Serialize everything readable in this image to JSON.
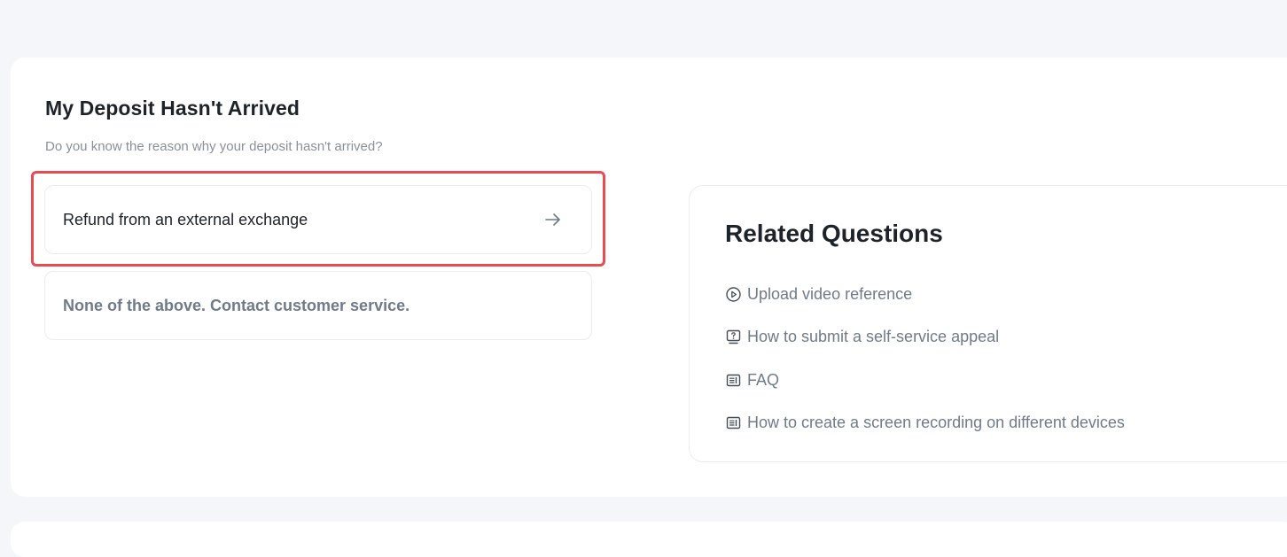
{
  "deposit": {
    "title": "My Deposit Hasn't Arrived",
    "subtitle": "Do you know the reason why your deposit hasn't arrived?",
    "options": [
      {
        "label": "Refund from an external exchange",
        "icon": "arrow-right-icon",
        "highlighted": true
      },
      {
        "label": "None of the above. Contact customer service."
      }
    ]
  },
  "related": {
    "title": "Related Questions",
    "items": [
      {
        "label": "Upload video reference",
        "icon": "play-circle-icon"
      },
      {
        "label": "How to submit a self-service appeal",
        "icon": "question-box-icon"
      },
      {
        "label": "FAQ",
        "icon": "document-icon"
      },
      {
        "label": "How to create a screen recording on different devices",
        "icon": "document-icon"
      }
    ]
  },
  "colors": {
    "highlight": "#e84c50",
    "text_primary": "#1e2329",
    "text_secondary": "#707a8a",
    "background": "#f4f6f9"
  }
}
